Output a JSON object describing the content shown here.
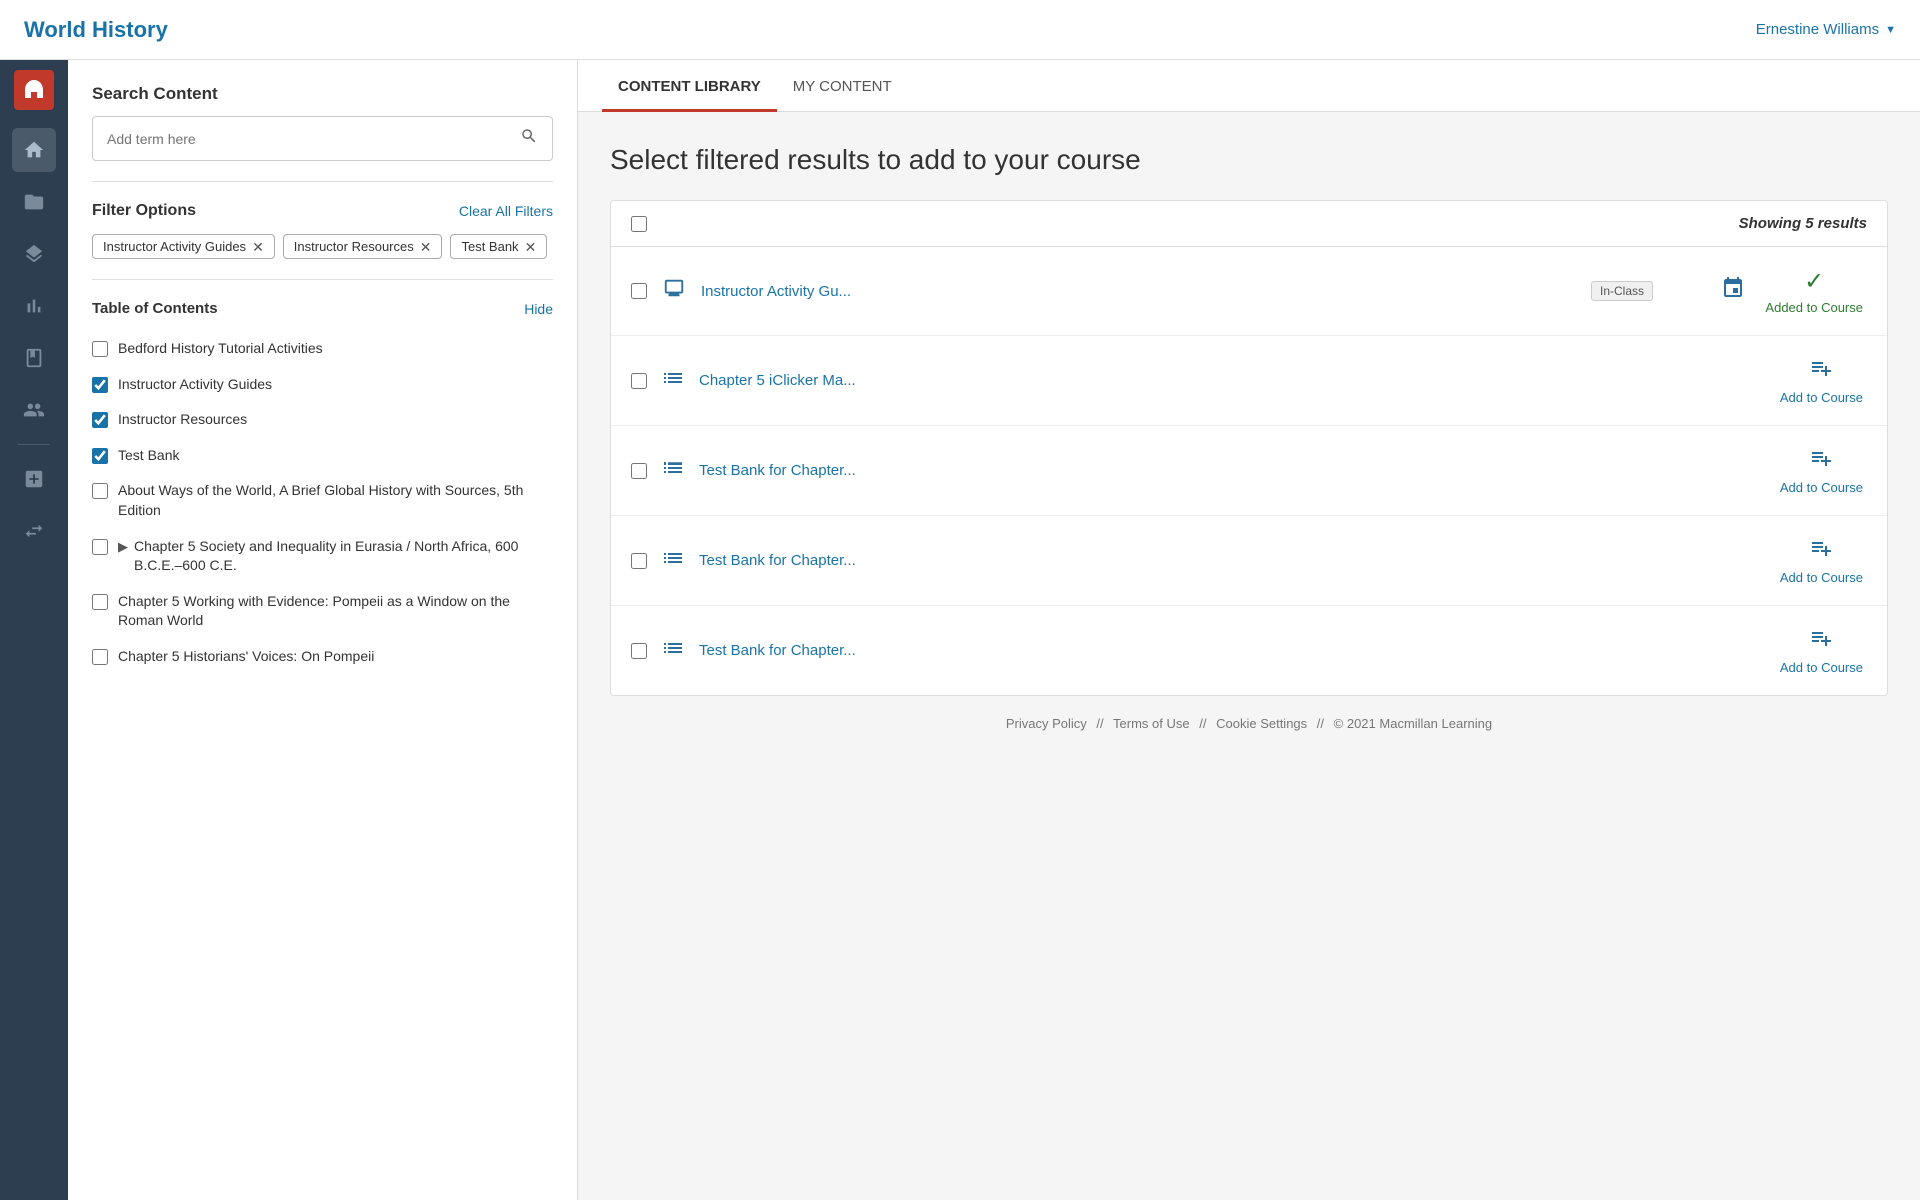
{
  "app": {
    "title": "World History",
    "user": "Ernestine Williams",
    "logo_alt": "Macmillan Learning"
  },
  "nav": {
    "items": [
      {
        "id": "home",
        "icon": "🏠",
        "label": "home-icon"
      },
      {
        "id": "folder",
        "icon": "📁",
        "label": "folder-icon"
      },
      {
        "id": "layers",
        "icon": "📚",
        "label": "layers-icon"
      },
      {
        "id": "chart",
        "icon": "📊",
        "label": "chart-icon"
      },
      {
        "id": "book",
        "icon": "📋",
        "label": "book-icon"
      },
      {
        "id": "users",
        "icon": "👥",
        "label": "users-icon"
      },
      {
        "id": "add",
        "icon": "➕",
        "label": "add-icon"
      },
      {
        "id": "transfer",
        "icon": "⇄",
        "label": "transfer-icon"
      }
    ]
  },
  "sidebar": {
    "search_title": "Search Content",
    "search_placeholder": "Add term here",
    "filter_title": "Filter Options",
    "clear_filters": "Clear All Filters",
    "tags": [
      {
        "label": "Instructor Activity Guides",
        "id": "tag-activity"
      },
      {
        "label": "Instructor Resources",
        "id": "tag-resources"
      },
      {
        "label": "Test Bank",
        "id": "tag-testbank"
      }
    ],
    "toc_title": "Table of Contents",
    "toc_hide": "Hide",
    "toc_items": [
      {
        "label": "Bedford History Tutorial Activities",
        "checked": false,
        "has_arrow": false
      },
      {
        "label": "Instructor Activity Guides",
        "checked": true,
        "has_arrow": false
      },
      {
        "label": "Instructor Resources",
        "checked": true,
        "has_arrow": false
      },
      {
        "label": "Test Bank",
        "checked": true,
        "has_arrow": false
      },
      {
        "label": "About Ways of the World, A Brief Global History with Sources, 5th Edition",
        "checked": false,
        "has_arrow": false
      },
      {
        "label": "Chapter 5 Society and Inequality in Eurasia / North Africa, 600 B.C.E.–600 C.E.",
        "checked": false,
        "has_arrow": true
      },
      {
        "label": "Chapter 5 Working with Evidence: Pompeii as a Window on the Roman World",
        "checked": false,
        "has_arrow": false
      },
      {
        "label": "Chapter 5 Historians' Voices: On Pompeii",
        "checked": false,
        "has_arrow": false
      }
    ]
  },
  "tabs": [
    {
      "id": "content-library",
      "label": "CONTENT LIBRARY",
      "active": true
    },
    {
      "id": "my-content",
      "label": "MY CONTENT",
      "active": false
    }
  ],
  "content": {
    "page_title": "Select filtered results to add to your course",
    "results_count_label": "Showing 5 results",
    "results": [
      {
        "id": "row1",
        "icon_type": "monitor",
        "title": "Instructor Activity Gu...",
        "badge": "In-Class",
        "added": true,
        "add_label": "Added to Course",
        "has_calendar": true
      },
      {
        "id": "row2",
        "icon_type": "list",
        "title": "Chapter 5 iClicker Ma...",
        "badge": "",
        "added": false,
        "add_label": "Add to Course",
        "has_calendar": false
      },
      {
        "id": "row3",
        "icon_type": "list-lines",
        "title": "Test Bank for Chapter...",
        "badge": "",
        "added": false,
        "add_label": "Add to Course",
        "has_calendar": false
      },
      {
        "id": "row4",
        "icon_type": "list-lines",
        "title": "Test Bank for Chapter...",
        "badge": "",
        "added": false,
        "add_label": "Add to Course",
        "has_calendar": false
      },
      {
        "id": "row5",
        "icon_type": "list-lines",
        "title": "Test Bank for Chapter...",
        "badge": "",
        "added": false,
        "add_label": "Add to Course",
        "has_calendar": false
      }
    ]
  },
  "footer": {
    "links": [
      "Privacy Policy",
      "Terms of Use",
      "Cookie Settings"
    ],
    "copyright": "© 2021 Macmillan Learning"
  }
}
